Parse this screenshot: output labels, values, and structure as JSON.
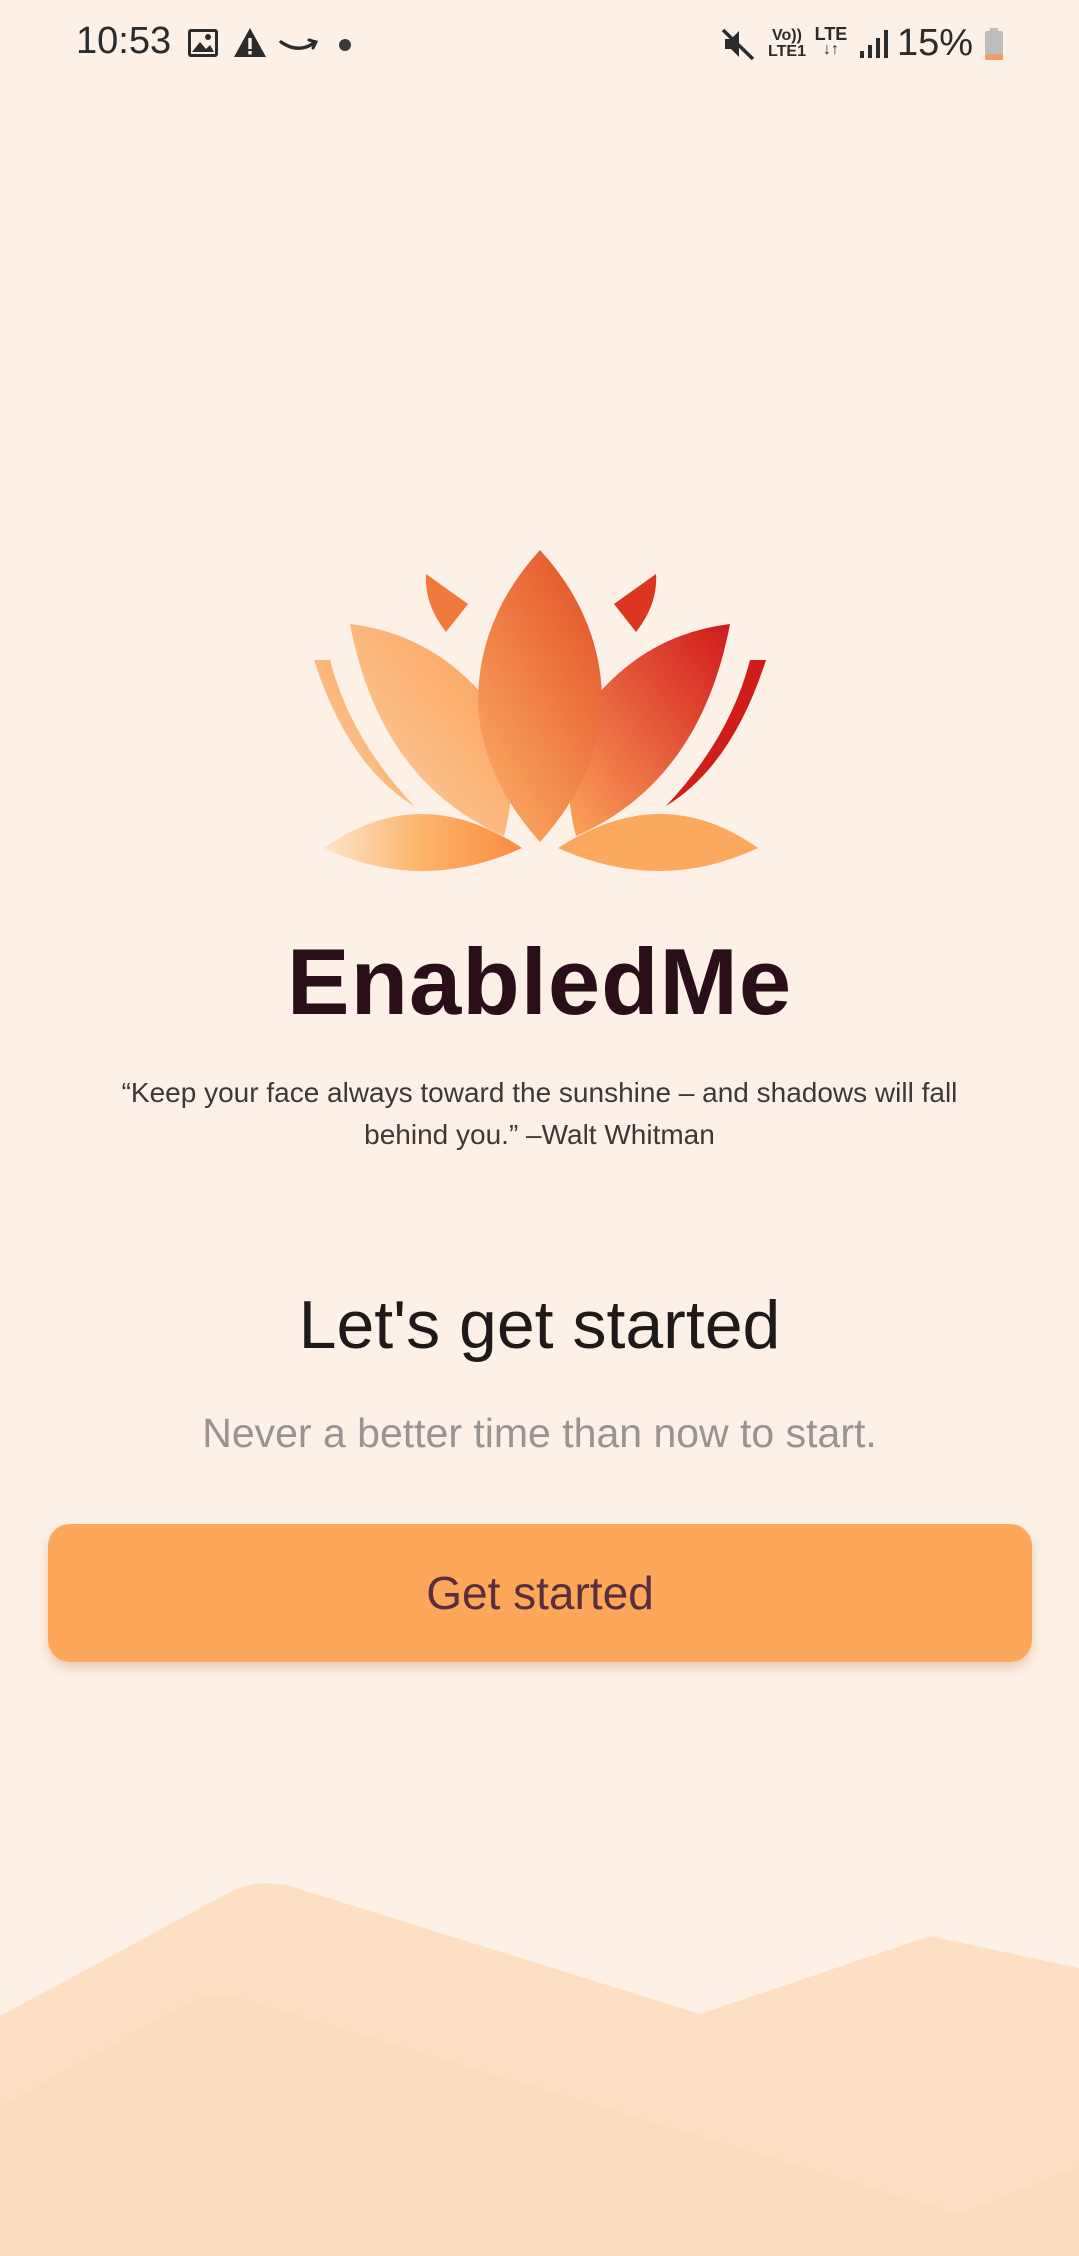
{
  "status_bar": {
    "time": "10:53",
    "icons": [
      "image-icon",
      "warning-icon",
      "amazon-icon",
      "notification-dot-icon",
      "mute-icon",
      "volte-icon",
      "lte-icon",
      "signal-icon",
      "battery-icon"
    ],
    "volte_label_top": "Vo))",
    "volte_label_bottom": "LTE1",
    "lte_label": "LTE",
    "battery_percent": "15%"
  },
  "app": {
    "name": "EnabledMe",
    "quote": "“Keep your face always toward the sunshine – and shadows will fall behind you.” –Walt Whitman",
    "headline": "Let's get started",
    "subline": "Never a better time than now to start.",
    "cta_label": "Get started"
  },
  "colors": {
    "background": "#fdf0e6",
    "button": "#fda75a",
    "button_text": "#5a2e3e",
    "brand_text": "#2a0e18",
    "logo_light": "#fdd5a6",
    "logo_mid": "#fca35a",
    "logo_dark": "#d0191c"
  }
}
